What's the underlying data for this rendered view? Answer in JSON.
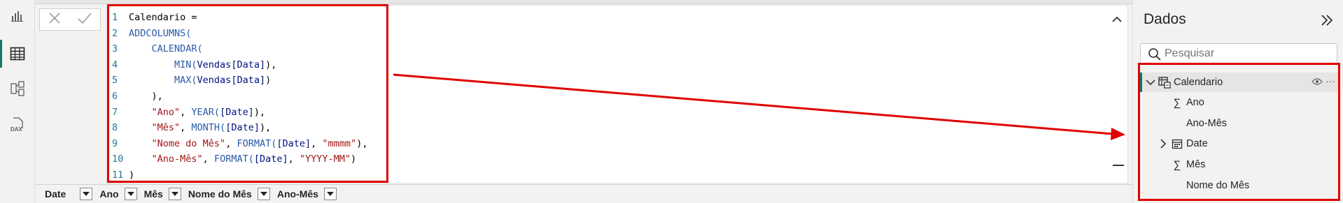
{
  "colors": {
    "highlight_red": "#e00000",
    "accent_green": "#117865",
    "keyword_blue": "#2b5aa8",
    "string_red": "#a31515",
    "column_navy": "#001080"
  },
  "left_rail": {
    "icons": [
      "report-view-icon",
      "table-view-icon",
      "model-view-icon",
      "dax-query-view-icon"
    ],
    "dax_label": "DAX"
  },
  "formula_bar": {
    "cancel_icon": "close-icon",
    "commit_icon": "check-icon",
    "lines": [
      {
        "n": "1"
      },
      {
        "n": "2"
      },
      {
        "n": "3"
      },
      {
        "n": "4"
      },
      {
        "n": "5"
      },
      {
        "n": "6"
      },
      {
        "n": "7"
      },
      {
        "n": "8"
      },
      {
        "n": "9"
      },
      {
        "n": "10"
      },
      {
        "n": "11"
      }
    ],
    "tokens": {
      "l1": "Calendario =",
      "l2": "ADDCOLUMNS(",
      "l3": "CALENDAR(",
      "l4_fn": "MIN(",
      "l4_col": "Vendas[Data]",
      "l4_end": "),",
      "l5_fn": "MAX(",
      "l5_col": "Vendas[Data]",
      "l5_end": ")",
      "l6": "),",
      "l7_str": "\"Ano\"",
      "l7_fn": "YEAR(",
      "l7_col": "[Date]",
      "l7_end": "),",
      "l8_str": "\"Mês\"",
      "l8_fn": "MONTH(",
      "l8_col": "[Date]",
      "l8_end": "),",
      "l9_str": "\"Nome do Mês\"",
      "l9_fn": "FORMAT(",
      "l9_col": "[Date]",
      "l9_fmt": "\"mmmm\"",
      "l9_end": "),",
      "l10_str": "\"Ano-Mês\"",
      "l10_fn": "FORMAT(",
      "l10_col": "[Date]",
      "l10_fmt": "\"YYYY-MM\"",
      "l10_end": ")",
      "l11": ")",
      "comma_sp": ", "
    }
  },
  "column_headers": [
    "Date",
    "Ano",
    "Mês",
    "Nome do Mês",
    "Ano-Mês"
  ],
  "data_pane": {
    "title": "Dados",
    "search_placeholder": "Pesquisar",
    "table": {
      "name": "Calendario"
    },
    "fields": [
      {
        "label": "Ano",
        "icon": "sigma-icon"
      },
      {
        "label": "Ano-Mês",
        "icon": ""
      },
      {
        "label": "Date",
        "icon": "calendar-icon"
      },
      {
        "label": "Mês",
        "icon": "sigma-icon"
      },
      {
        "label": "Nome do Mês",
        "icon": ""
      }
    ],
    "more_glyph": "···"
  }
}
